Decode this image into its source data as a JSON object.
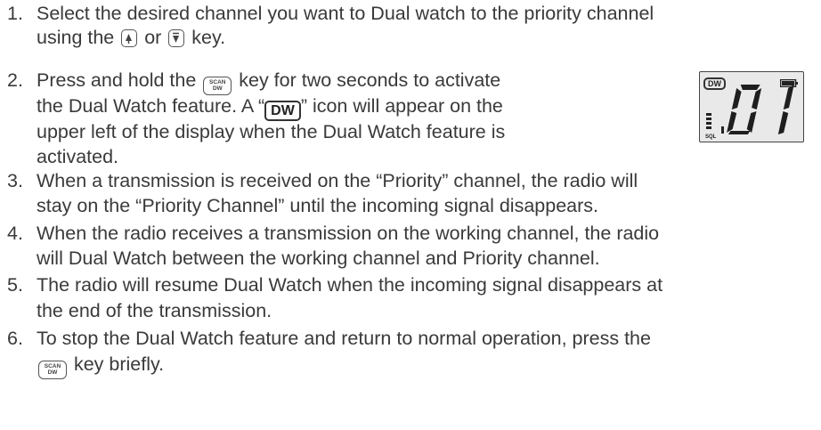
{
  "steps": [
    {
      "number": "1.",
      "lines": [
        "Select the desired channel you want to Dual watch to the priority channel",
        [
          "using the ",
          {
            "key": "up"
          },
          " or ",
          {
            "key": "down"
          },
          " key."
        ]
      ]
    },
    {
      "number": "2.",
      "lines": [
        [
          "Press and hold the ",
          {
            "key": "scan"
          },
          " key for two seconds to activate"
        ],
        [
          "the Dual Watch feature. A “",
          {
            "key": "dw"
          },
          "” icon will appear on the"
        ],
        "upper left of the display when the Dual Watch feature is",
        "activated."
      ]
    },
    {
      "number": "3.",
      "lines": [
        "When a transmission is received on the “Priority” channel, the radio will",
        "stay on the “Priority Channel” until the incoming signal disappears."
      ]
    },
    {
      "number": "4.",
      "lines": [
        "When the radio receives a transmission on the working channel, the radio",
        "will Dual Watch between the working channel and Priority channel."
      ]
    },
    {
      "number": "5.",
      "lines": [
        "The radio will resume Dual Watch when the incoming signal disappears at",
        "the end of the transmission."
      ]
    },
    {
      "number": "6.",
      "lines": [
        "To stop the Dual Watch feature and return to normal operation, press the",
        [
          {
            "key": "scan"
          },
          " key briefly."
        ]
      ]
    }
  ],
  "keys": {
    "scan_top": "SCAN",
    "scan_bottom": "DW",
    "dw_label": "DW"
  },
  "display": {
    "dw_icon": "DW",
    "channel": "01",
    "sql_label": "SQL",
    "battery_icon": "battery-icon",
    "squelch_level": 4
  },
  "colors": {
    "text": "#3a3a3a",
    "lcd_background": "#e9e9e9"
  }
}
